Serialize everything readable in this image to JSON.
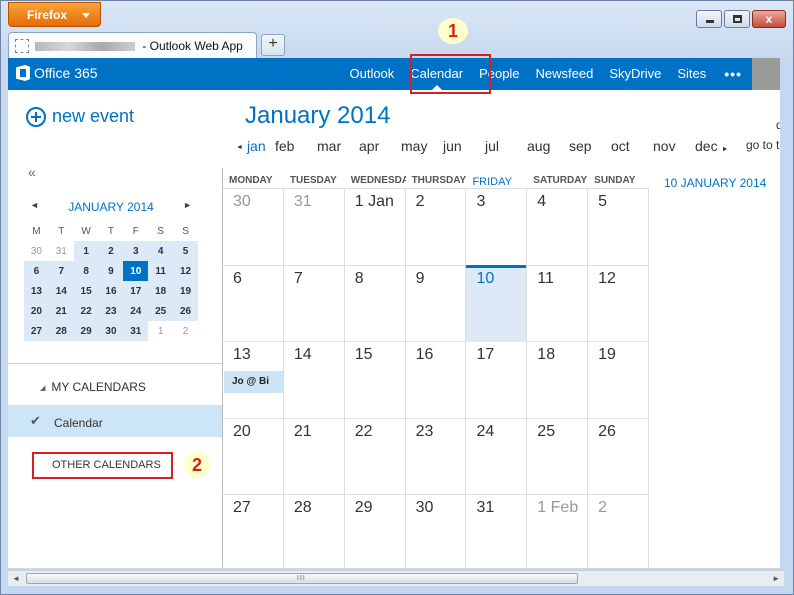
{
  "browser": {
    "menu_label": "Firefox",
    "tab_title": "- Outlook Web App",
    "new_tab_label": "+",
    "close_label": "x"
  },
  "topbar": {
    "brand": "Office 365",
    "nav": [
      "Outlook",
      "Calendar",
      "People",
      "Newsfeed",
      "SkyDrive",
      "Sites"
    ],
    "more_label": "•••"
  },
  "sidebar": {
    "new_event_label": "new event",
    "collapse_label": "«",
    "mini_calendar": {
      "title": "JANUARY 2014",
      "prev": "◄",
      "next": "►",
      "day_headers": [
        "M",
        "T",
        "W",
        "T",
        "F",
        "S",
        "S"
      ],
      "weeks": [
        [
          "30",
          "31",
          "1",
          "2",
          "3",
          "4",
          "5"
        ],
        [
          "6",
          "7",
          "8",
          "9",
          "10",
          "11",
          "12"
        ],
        [
          "13",
          "14",
          "15",
          "16",
          "17",
          "18",
          "19"
        ],
        [
          "20",
          "21",
          "22",
          "23",
          "24",
          "25",
          "26"
        ],
        [
          "27",
          "28",
          "29",
          "30",
          "31",
          "1",
          "2"
        ]
      ]
    },
    "my_calendars_label": "MY CALENDARS",
    "calendar_item": "Calendar",
    "check_glyph": "✔",
    "other_calendars_label": "OTHER CALENDARS"
  },
  "main": {
    "month_title": "January 2014",
    "months": [
      "jan",
      "feb",
      "mar",
      "apr",
      "may",
      "jun",
      "jul",
      "aug",
      "sep",
      "oct",
      "nov",
      "dec"
    ],
    "go_to": "go to to",
    "edge_letter": "d",
    "day_headers": [
      "MONDAY",
      "TUESDAY",
      "WEDNESDAY",
      "THURSDAY",
      "FRIDAY",
      "SATURDAY",
      "SUNDAY"
    ],
    "weeks": [
      [
        "30",
        "31",
        "1 Jan",
        "2",
        "3",
        "4",
        "5"
      ],
      [
        "6",
        "7",
        "8",
        "9",
        "10",
        "11",
        "12"
      ],
      [
        "13",
        "14",
        "15",
        "16",
        "17",
        "18",
        "19"
      ],
      [
        "20",
        "21",
        "22",
        "23",
        "24",
        "25",
        "26"
      ],
      [
        "27",
        "28",
        "29",
        "30",
        "31",
        "1 Feb",
        "2"
      ]
    ],
    "event_label": "Jo @ Bi",
    "selected_date_label": "10 JANUARY 2014"
  },
  "annotations": {
    "step1": "1",
    "step2": "2",
    "highlight_color": "#d91f1f"
  },
  "scrollbar": {
    "grip": "III"
  }
}
